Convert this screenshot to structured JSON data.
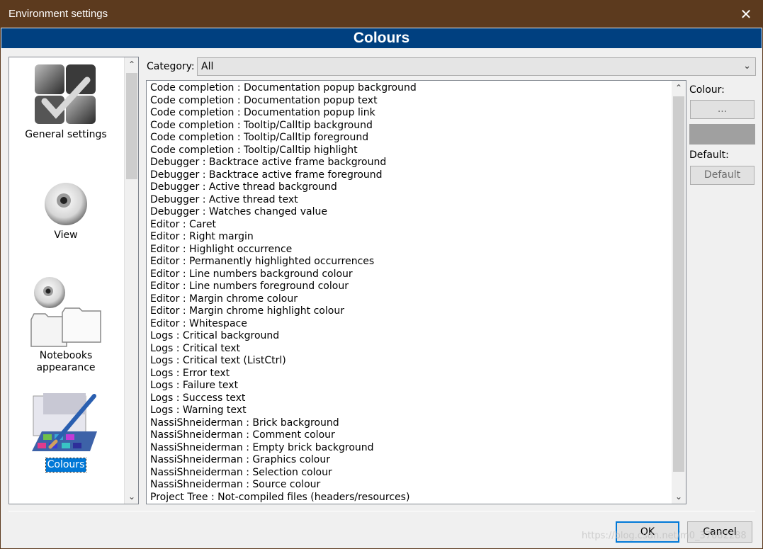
{
  "window": {
    "title": "Environment settings",
    "close_icon": "close-icon"
  },
  "header": {
    "title": "Colours"
  },
  "sidebar": {
    "items": [
      {
        "label": "General settings",
        "icon": "general-settings-icon"
      },
      {
        "label": "View",
        "icon": "eye-icon"
      },
      {
        "label": "Notebooks appearance",
        "icon": "notebooks-icon"
      },
      {
        "label": "Colours",
        "icon": "palette-icon",
        "selected": true
      }
    ]
  },
  "category": {
    "label": "Category:",
    "value": "All"
  },
  "list": {
    "items": [
      "Code completion : Documentation popup background",
      "Code completion : Documentation popup text",
      "Code completion : Documentation popup link",
      "Code completion : Tooltip/Calltip background",
      "Code completion : Tooltip/Calltip foreground",
      "Code completion : Tooltip/Calltip highlight",
      "Debugger : Backtrace active frame background",
      "Debugger : Backtrace active frame foreground",
      "Debugger : Active thread background",
      "Debugger : Active thread text",
      "Debugger : Watches changed value",
      "Editor : Caret",
      "Editor : Right margin",
      "Editor : Highlight occurrence",
      "Editor : Permanently highlighted occurrences",
      "Editor : Line numbers background colour",
      "Editor : Line numbers foreground colour",
      "Editor : Margin chrome colour",
      "Editor : Margin chrome highlight colour",
      "Editor : Whitespace",
      "Logs : Critical background",
      "Logs : Critical text",
      "Logs : Critical text (ListCtrl)",
      "Logs : Error text",
      "Logs : Failure text",
      "Logs : Success text",
      "Logs : Warning text",
      "NassiShneiderman : Brick background",
      "NassiShneiderman : Comment colour",
      "NassiShneiderman : Empty brick background",
      "NassiShneiderman : Graphics colour",
      "NassiShneiderman : Selection colour",
      "NassiShneiderman : Source colour",
      "Project Tree : Not-compiled files (headers/resources)"
    ]
  },
  "colour_panel": {
    "colour_label": "Colour:",
    "colour_button": "...",
    "swatch_color": "#a0a0a0",
    "default_label": "Default:",
    "default_button": "Default"
  },
  "footer": {
    "ok": "OK",
    "cancel": "Cancel",
    "watermark": "https://blog.csdn.net/m0_37662288"
  },
  "colors": {
    "titlebar": "#5c3a1e",
    "header": "#004080",
    "accent": "#0078d7"
  }
}
